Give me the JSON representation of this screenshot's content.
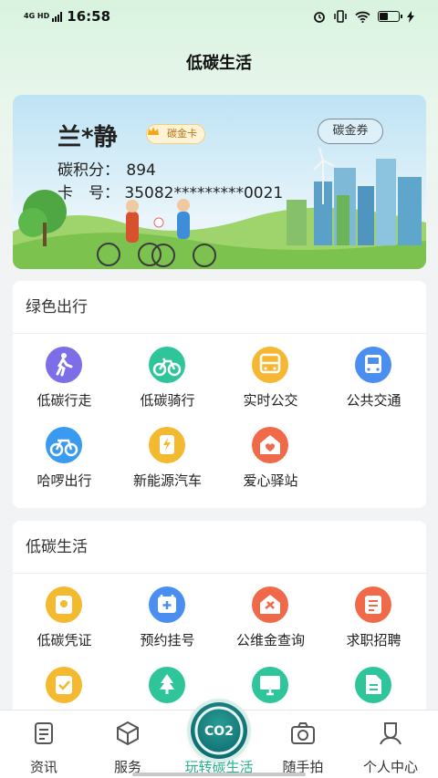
{
  "status_bar": {
    "network": "4G HD",
    "time": "16:58"
  },
  "header": {
    "title": "低碳生活"
  },
  "card": {
    "name": "兰*静",
    "badge": "碳金卡",
    "coupon_button": "碳金券",
    "points_label": "碳积分：",
    "points_value": "894",
    "card_no_label": "卡　号：",
    "card_no_value": "35082*********0021"
  },
  "green_travel": {
    "title": "绿色出行",
    "items": [
      {
        "label": "低碳行走",
        "icon": "walking-icon",
        "color": "#7c6ee6"
      },
      {
        "label": "低碳骑行",
        "icon": "bike-icon",
        "color": "#2fc59a"
      },
      {
        "label": "实时公交",
        "icon": "bus-realtime-icon",
        "color": "#f5b731"
      },
      {
        "label": "公共交通",
        "icon": "public-transport-icon",
        "color": "#4a8ff0"
      },
      {
        "label": "哈啰出行",
        "icon": "hello-bike-icon",
        "color": "#3a9af0"
      },
      {
        "label": "新能源汽车",
        "icon": "ev-charging-icon",
        "color": "#f3b92f"
      },
      {
        "label": "爱心驿站",
        "icon": "love-station-icon",
        "color": "#f06a4a"
      }
    ]
  },
  "low_carbon_life": {
    "title": "低碳生活",
    "items": [
      {
        "label": "低碳凭证",
        "icon": "certificate-icon",
        "color": "#f3b92f"
      },
      {
        "label": "预约挂号",
        "icon": "calendar-plus-icon",
        "color": "#4a8ff0"
      },
      {
        "label": "公维金查询",
        "icon": "house-tools-icon",
        "color": "#f06a4a"
      },
      {
        "label": "求职招聘",
        "icon": "recruit-icon",
        "color": "#f06a4a"
      },
      {
        "label": "",
        "icon": "checklist-icon",
        "color": "#f3b92f"
      },
      {
        "label": "",
        "icon": "tree-icon",
        "color": "#2fc59a"
      },
      {
        "label": "",
        "icon": "monitor-icon",
        "color": "#2fc59a"
      },
      {
        "label": "",
        "icon": "document-icon",
        "color": "#2fc59a"
      }
    ]
  },
  "bottom_nav": [
    {
      "label": "资讯",
      "icon": "news-icon"
    },
    {
      "label": "服务",
      "icon": "cube-icon"
    },
    {
      "label": "玩转碳生活",
      "icon": "co2-icon",
      "active": true
    },
    {
      "label": "随手拍",
      "icon": "camera-icon"
    },
    {
      "label": "个人中心",
      "icon": "user-icon"
    }
  ],
  "co2_label": "CO2"
}
